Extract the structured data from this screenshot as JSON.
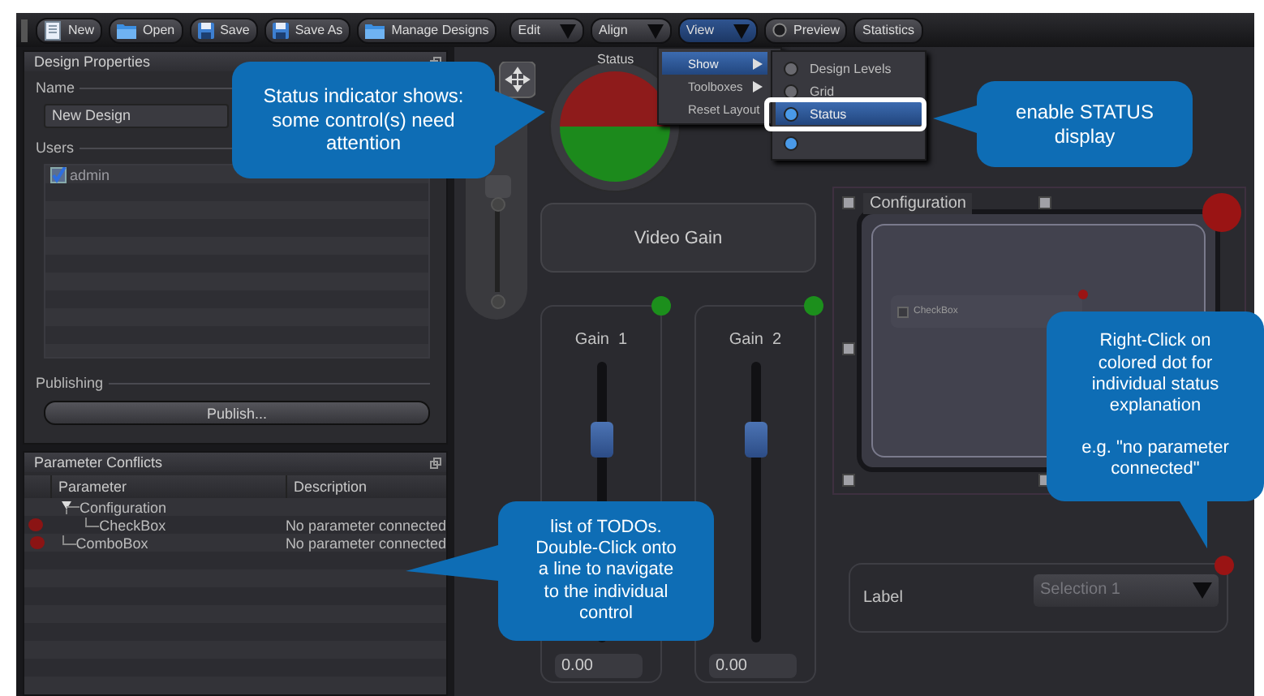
{
  "toolbar": {
    "buttons": [
      {
        "label": "New",
        "kind": "page",
        "selected": false
      },
      {
        "label": "Open",
        "kind": "folder",
        "selected": false
      },
      {
        "label": "Save",
        "kind": "disk",
        "selected": false
      },
      {
        "label": "Save As",
        "kind": "disk",
        "selected": false
      },
      {
        "label": "Manage Designs",
        "kind": "folder",
        "selected": false
      },
      {
        "label": "Edit",
        "kind": "menu",
        "selected": false
      },
      {
        "label": "Align",
        "kind": "menu",
        "selected": false
      },
      {
        "label": "View",
        "kind": "menu",
        "selected": true
      },
      {
        "label": "Preview",
        "kind": "radio",
        "selected": false
      },
      {
        "label": "Statistics",
        "kind": "plain",
        "selected": false
      }
    ]
  },
  "design_properties": {
    "title": "Design Properties",
    "name_label": "Name",
    "name_value": "New Design",
    "users_label": "Users",
    "users": [
      {
        "name": "admin",
        "checked": true
      }
    ],
    "publishing_label": "Publishing",
    "publish_button": "Publish..."
  },
  "parameter_conflicts": {
    "title": "Parameter Conflicts",
    "columns": [
      "Parameter",
      "Description"
    ],
    "rows": [
      {
        "parameter": "Configuration",
        "expanded": true,
        "children": [
          {
            "parameter": "CheckBox",
            "description": "No parameter connected",
            "color": "#8b1414"
          }
        ]
      },
      {
        "parameter": "ComboBox",
        "description": "No parameter connected",
        "color": "#8b1414"
      }
    ]
  },
  "view_menu": {
    "items": [
      {
        "label": "Show",
        "selected": true,
        "submenu": true
      },
      {
        "label": "Toolboxes",
        "selected": false,
        "submenu": true
      },
      {
        "label": "Reset Layout",
        "selected": false,
        "submenu": false
      }
    ]
  },
  "show_submenu": {
    "items": [
      {
        "label": "Design Levels",
        "on": false,
        "selected": false
      },
      {
        "label": "Grid",
        "on": false,
        "selected": false
      },
      {
        "label": "Status",
        "on": true,
        "selected": true
      },
      {
        "on": true,
        "selected": false
      }
    ]
  },
  "canvas": {
    "status_indicator": {
      "label": "Status"
    },
    "video_gain": {
      "label": "Video Gain"
    },
    "gains": [
      {
        "label": "Gain  1",
        "level": 0.72,
        "value": "0.00",
        "color": "#1c8f1c"
      },
      {
        "label": "Gain  2",
        "level": 0.72,
        "value": "0.00",
        "color": "#1c8f1c"
      }
    ],
    "configuration": {
      "title": "Configuration",
      "color": "#9a1414",
      "checkbox": {
        "label": "CheckBox",
        "checked": false,
        "color": "#9a1414"
      }
    },
    "combo": {
      "label": "Label",
      "value": "Selection 1",
      "color": "#9a1414"
    }
  },
  "callouts": [
    {
      "text": "Status indicator shows:\nsome control(s) need\nattention"
    },
    {
      "text": "enable STATUS\ndisplay"
    },
    {
      "text": "Right-Click on\ncolored dot for\nindividual status\nexplanation\n\ne.g. \"no parameter\nconnected\""
    },
    {
      "text": "list of TODOs.\nDouble-Click onto\na line to navigate\nto the individual\ncontrol"
    }
  ]
}
